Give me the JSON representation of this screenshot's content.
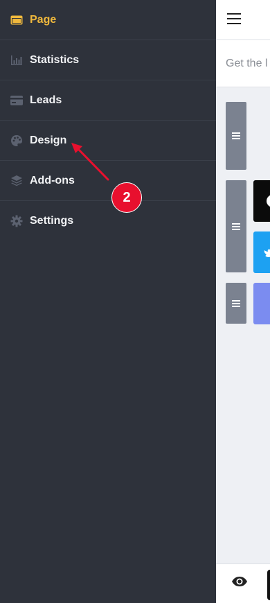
{
  "sidebar": {
    "items": [
      {
        "label": "Page",
        "icon": "browser-window-icon",
        "active": true
      },
      {
        "label": "Statistics",
        "icon": "bar-chart-icon",
        "active": false
      },
      {
        "label": "Leads",
        "icon": "credit-card-icon",
        "active": false
      },
      {
        "label": "Design",
        "icon": "palette-icon",
        "active": false
      },
      {
        "label": "Add-ons",
        "icon": "layers-icon",
        "active": false
      },
      {
        "label": "Settings",
        "icon": "gear-icon",
        "active": false
      }
    ]
  },
  "content": {
    "subhead_text": "Get the l"
  },
  "annotation": {
    "step_number": "2"
  },
  "colors": {
    "sidebar_bg": "#2e323b",
    "active_accent": "#f0b93d",
    "annotation_red": "#e8102e",
    "twitter_blue": "#1da1f2",
    "tile_purple": "#7b8cf0"
  }
}
